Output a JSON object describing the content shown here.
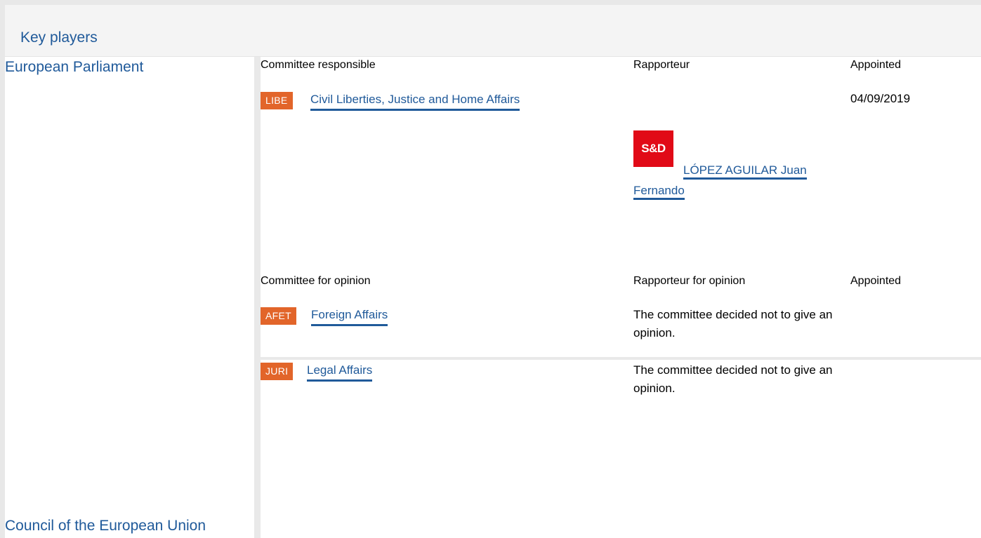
{
  "header": {
    "title": "Key players"
  },
  "institutions": {
    "parliament": "European Parliament",
    "council": "Council of the European Union"
  },
  "responsible": {
    "col_committee": "Committee responsible",
    "col_rapporteur": "Rapporteur",
    "col_appointed": "Appointed",
    "committee": {
      "code": "LIBE",
      "name": "Civil Liberties, Justice and Home Affairs"
    },
    "appointed": "04/09/2019",
    "rapporteur": {
      "party": "S&D",
      "name": "LÓPEZ AGUILAR Juan Fernando"
    }
  },
  "opinion": {
    "col_committee": "Committee for opinion",
    "col_rapporteur": "Rapporteur for opinion",
    "col_appointed": "Appointed",
    "rows": [
      {
        "code": "AFET",
        "name": "Foreign Affairs",
        "rapporteur": "The committee decided not to give an opinion."
      },
      {
        "code": "JURI",
        "name": "Legal Affairs",
        "rapporteur": "The committee decided not to give an opinion."
      }
    ]
  },
  "colors": {
    "link": "#205a9a",
    "badge": "#e2652a",
    "party_logo": "#e10a17",
    "separator": "#e9e9e9"
  },
  "icons": {
    "party_logo": "s-and-d-logo"
  }
}
